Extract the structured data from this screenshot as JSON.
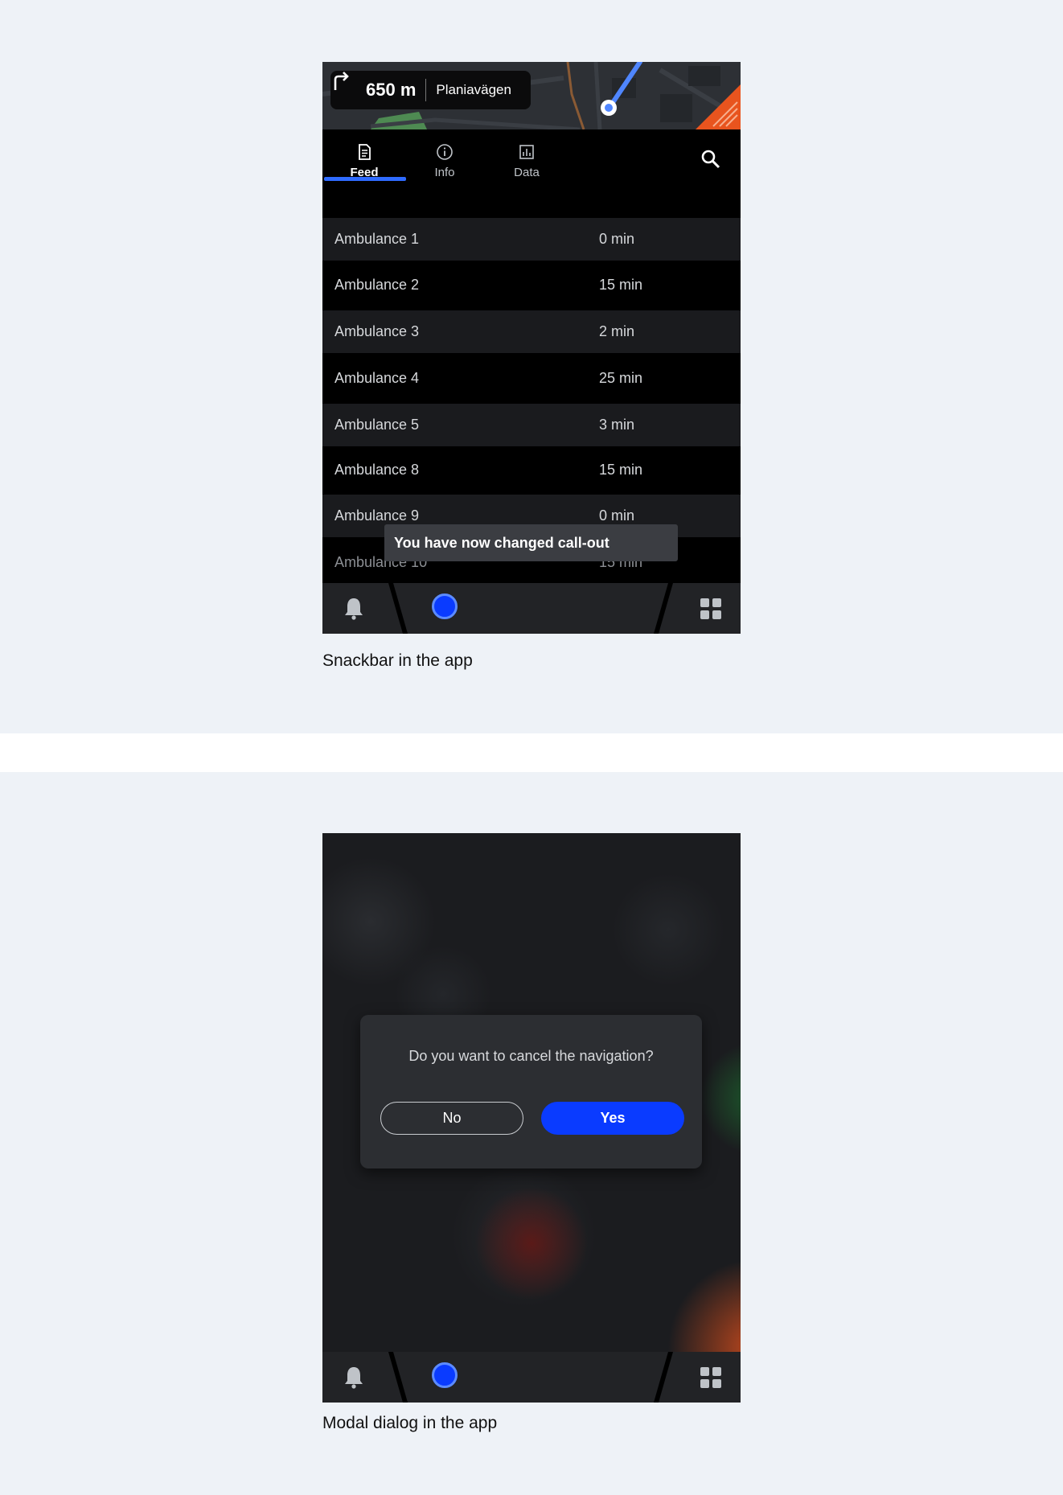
{
  "snackbar_screen": {
    "map": {
      "distance": "650 m",
      "street": "Planiavägen"
    },
    "tabs": [
      {
        "label": "Feed",
        "icon": "document-icon",
        "active": true
      },
      {
        "label": "Info",
        "icon": "info-icon",
        "active": false
      },
      {
        "label": "Data",
        "icon": "chart-icon",
        "active": false
      }
    ],
    "rows": [
      {
        "name": "Ambulance 1",
        "eta": "0 min"
      },
      {
        "name": "Ambulance 2",
        "eta": "15 min"
      },
      {
        "name": "Ambulance 3",
        "eta": "2 min"
      },
      {
        "name": "Ambulance 4",
        "eta": "25 min"
      },
      {
        "name": "Ambulance 5",
        "eta": "3 min"
      },
      {
        "name": "Ambulance 8",
        "eta": "15 min"
      },
      {
        "name": "Ambulance 9",
        "eta": "0 min"
      },
      {
        "name": "Ambulance 10",
        "eta": "15 min"
      }
    ],
    "snackbar_text": "You have now changed call-out",
    "caption": "Snackbar in the app"
  },
  "modal_screen": {
    "dialog_text": "Do you want to cancel the navigation?",
    "no_label": "No",
    "yes_label": "Yes",
    "caption": "Modal dialog in the app"
  },
  "colors": {
    "accent_blue": "#0a3bff",
    "tab_indicator": "#2f6bff",
    "background": "#eef2f7"
  }
}
